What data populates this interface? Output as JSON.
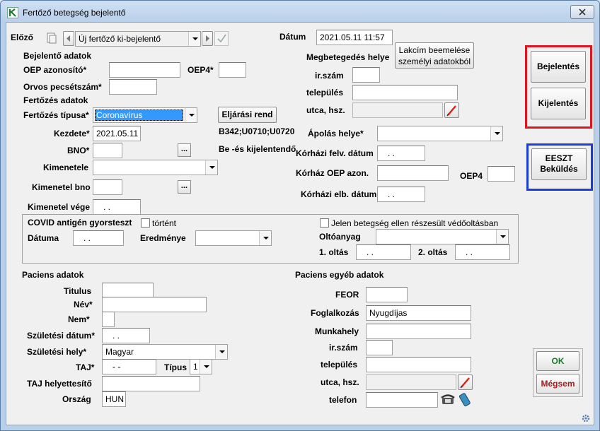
{
  "window": {
    "title": "Fertőző betegség bejelentő"
  },
  "nav": {
    "prev_label": "Előző",
    "record_value": "Új fertőző ki-bejelentő"
  },
  "date": {
    "label": "Dátum",
    "value": "2021.05.11 11:57"
  },
  "reporter": {
    "heading": "Bejelentő adatok",
    "oep_label": "OEP azonosító*",
    "oep4_label": "OEP4*",
    "doctor_label": "Orvos pecsétszám*"
  },
  "infection": {
    "heading": "Fertőzés adatok",
    "type_label": "Fertőzés típusa*",
    "type_value": "Coronavírus",
    "procedure_button": "Eljárási rend",
    "start_label": "Kezdete*",
    "start_value": "2021.05.11",
    "codes_text": "B342;U0710;U0720",
    "bno_label": "BNO*",
    "report_type_text": "Be -és kijelentendő",
    "outcome_label": "Kimenetele",
    "outcome_bno_label": "Kimenetel bno",
    "outcome_end_label": "Kimenetel vége",
    "outcome_end_value": ". ."
  },
  "illness_place": {
    "heading": "Megbetegedés helye",
    "address_button": "Lakcím beemelése személyi adatokból",
    "zip_label": "ir.szám",
    "city_label": "település",
    "street_label": "utca, hsz."
  },
  "care": {
    "place_label": "Ápolás helye*",
    "hosp_admission_label": "Kórházi felv. dátum",
    "hosp_admission_value": ". .",
    "hosp_oep_label": "Kórház OEP azon.",
    "oep4_label": "OEP4",
    "hosp_discharge_label": "Kórházi elb. dátum",
    "hosp_discharge_value": ". ."
  },
  "covid": {
    "heading": "COVID antigén gyorsteszt",
    "happened_label": "történt",
    "date_label": "Dátuma",
    "date_value": ". .",
    "result_label": "Eredménye",
    "vaccine_check_label": "Jelen betegség ellen részesült védőoltásban",
    "vaccine_label": "Oltóanyag",
    "dose1_label": "1. oltás",
    "dose1_value": ". .",
    "dose2_label": "2. oltás",
    "dose2_value": ". ."
  },
  "patient": {
    "heading": "Paciens adatok",
    "title_label": "Titulus",
    "name_label": "Név*",
    "sex_label": "Nem*",
    "birth_date_label": "Születési dátum*",
    "birth_date_value": ". .",
    "birth_place_label": "Születési hely*",
    "birth_place_value": "Magyar",
    "taj_label": "TAJ*",
    "taj_value": "- -",
    "type_label": "Típus",
    "type_value": "1",
    "taj_sub_label": "TAJ helyettesítő",
    "country_label": "Ország",
    "country_value": "HUN"
  },
  "patient_other": {
    "heading": "Paciens egyéb adatok",
    "feor_label": "FEOR",
    "occupation_label": "Foglalkozás",
    "occupation_value": "Nyugdíjas",
    "workplace_label": "Munkahely",
    "zip_label": "ir.szám",
    "city_label": "település",
    "street_label": "utca, hsz.",
    "phone_label": "telefon"
  },
  "actions": {
    "report_label": "Bejelentés",
    "dereport_label": "Kijelentés",
    "eeszt_label_1": "EESZT",
    "eeszt_label_2": "Beküldés",
    "ok_label": "OK",
    "cancel_label": "Mégsem"
  },
  "colors": {
    "red_highlight": "#e0141e",
    "blue_highlight": "#1a3ed8",
    "ok_green": "#1a7a2a",
    "cancel_red": "#a02020",
    "selection_blue": "#3399ff"
  }
}
